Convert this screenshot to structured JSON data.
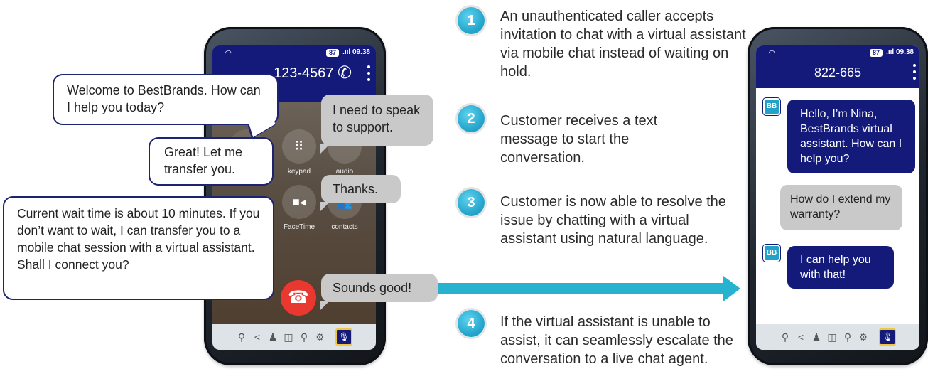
{
  "left_phone": {
    "status": {
      "battery": "87",
      "signal": ".ııl 09.38"
    },
    "phone_number": "123-4567",
    "buttons": [
      {
        "label": "keypad",
        "icon": "keypad-icon"
      },
      {
        "label": "audio",
        "icon": "speaker-icon"
      },
      {
        "label": "FaceTime",
        "icon": "video-icon"
      },
      {
        "label": "contacts",
        "icon": "contacts-icon"
      }
    ]
  },
  "right_phone": {
    "status": {
      "battery": "87",
      "signal": ".ııl 09.38"
    },
    "title": "822-665",
    "messages": [
      {
        "from": "bot",
        "text": "Hello, I’m Nina, BestBrands virtual assistant. How can I help you?"
      },
      {
        "from": "user",
        "text": "How do I extend my warranty?"
      },
      {
        "from": "bot",
        "text": "I can help you with that!"
      }
    ],
    "logo_text": "BB"
  },
  "call_bubbles": {
    "welcome": "Welcome to BestBrands. How can I help you today?",
    "need_support": "I need to speak to support.",
    "great": "Great! Let me transfer you.",
    "thanks": "Thanks.",
    "wait_time": "Current wait time is about 10 minutes. If you don’t want to wait, I can transfer you to a mobile chat session with a virtual assistant. Shall I connect you?",
    "sounds_good": "Sounds good!"
  },
  "steps": [
    {
      "num": "1",
      "text": "An unauthenticated caller accepts invitation to chat with a virtual assistant via mobile chat instead of waiting on hold."
    },
    {
      "num": "2",
      "text": "Customer receives a text message to start the conversation."
    },
    {
      "num": "3",
      "text": "Customer is now able to resolve the issue by chatting with a virtual assistant using natural language."
    },
    {
      "num": "4",
      "text": "If the virtual assistant is unable to assist, it can seamlessly escalate the conversation to a live chat agent."
    }
  ],
  "colors": {
    "navy": "#141a7a",
    "teal": "#27b3cf",
    "gray_bubble": "#c9c9c9"
  }
}
